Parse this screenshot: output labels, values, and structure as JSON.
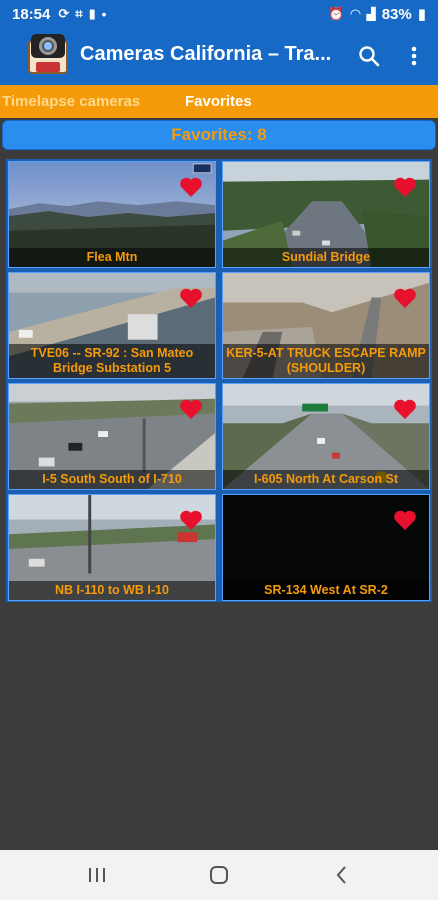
{
  "status_bar": {
    "time": "18:54",
    "icons": [
      "sync-icon",
      "hash-icon",
      "notification-icon",
      "dot-icon"
    ],
    "battery": "83%"
  },
  "app_bar": {
    "title": "Cameras California – Tra...",
    "search_icon": "search-icon",
    "menu_icon": "more-vert-icon"
  },
  "tabs": [
    {
      "label": "Timelapse cameras",
      "active": false
    },
    {
      "label": "Favorites",
      "active": true
    }
  ],
  "favorites_header": "Favorites: 8",
  "colors": {
    "primary": "#1669c4",
    "accent": "#f59b0a",
    "heart": "#e8112d"
  },
  "cameras": [
    {
      "label": "Flea Mtn",
      "favorite": true
    },
    {
      "label": "Sundial Bridge",
      "favorite": true
    },
    {
      "label": "TVE06 -- SR-92 : San Mateo Bridge Substation 5",
      "favorite": true
    },
    {
      "label": "KER-5-AT TRUCK ESCAPE RAMP (SHOULDER)",
      "favorite": true
    },
    {
      "label": "I-5 South South of I-710",
      "favorite": true
    },
    {
      "label": "I-605 North At Carson St",
      "favorite": true
    },
    {
      "label": "NB I-110 to WB I-10",
      "favorite": true
    },
    {
      "label": "SR-134 West At SR-2",
      "favorite": true
    }
  ],
  "nav_bar": [
    "recents-icon",
    "home-icon",
    "back-icon"
  ]
}
